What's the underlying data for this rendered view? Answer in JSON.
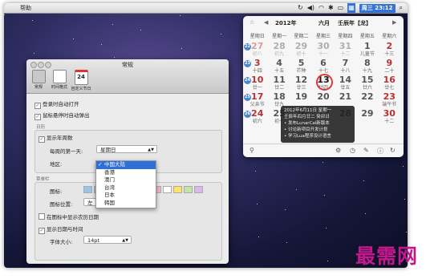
{
  "menubar": {
    "help_label": "帮助",
    "clock": "周三 23:12"
  },
  "calendar": {
    "year": "2012年",
    "month": "六月",
    "ganzhi": "壬辰年【龙】",
    "weekdays": [
      "星期日",
      "星期一",
      "星期二",
      "星期三",
      "星期四",
      "星期五",
      "星期六"
    ],
    "weeks": [
      {
        "badge": "22",
        "days": [
          {
            "d": "27",
            "l": "初八",
            "dim": true
          },
          {
            "d": "28",
            "l": "初九",
            "dim": true
          },
          {
            "d": "29",
            "l": "初十",
            "dim": true
          },
          {
            "d": "30",
            "l": "十一",
            "dim": true
          },
          {
            "d": "31",
            "l": "十二",
            "dim": true
          },
          {
            "d": "1",
            "l": "儿童节"
          },
          {
            "d": "2",
            "l": "十三"
          }
        ]
      },
      {
        "badge": "23",
        "days": [
          {
            "d": "3",
            "l": "十四"
          },
          {
            "d": "4",
            "l": "十五"
          },
          {
            "d": "5",
            "l": "芒种"
          },
          {
            "d": "6",
            "l": "十七"
          },
          {
            "d": "7",
            "l": "十八"
          },
          {
            "d": "8",
            "l": "十九"
          },
          {
            "d": "9",
            "l": "二十"
          }
        ]
      },
      {
        "badge": "24",
        "days": [
          {
            "d": "10",
            "l": "廿一"
          },
          {
            "d": "11",
            "l": "廿二"
          },
          {
            "d": "12",
            "l": "廿三"
          },
          {
            "d": "13",
            "l": "廿四",
            "today": true
          },
          {
            "d": "14",
            "l": "廿五"
          },
          {
            "d": "15",
            "l": "廿六"
          },
          {
            "d": "16",
            "l": "廿七"
          }
        ]
      },
      {
        "badge": "25",
        "days": [
          {
            "d": "17",
            "l": "父亲节"
          },
          {
            "d": "18",
            "l": "廿九"
          },
          {
            "d": "19",
            "l": ""
          },
          {
            "d": "20",
            "l": ""
          },
          {
            "d": "21",
            "l": ""
          },
          {
            "d": "22",
            "l": ""
          },
          {
            "d": "23",
            "l": "端午节"
          }
        ]
      },
      {
        "badge": "26",
        "days": [
          {
            "d": "24",
            "l": "初六"
          },
          {
            "d": "25",
            "l": "初七"
          },
          {
            "d": "26",
            "l": ""
          },
          {
            "d": "27",
            "l": ""
          },
          {
            "d": "28",
            "l": ""
          },
          {
            "d": "29",
            "l": ""
          },
          {
            "d": "30",
            "l": "十二"
          }
        ]
      }
    ],
    "tooltip": {
      "line1": "2012年6月11日 星期一",
      "line2": "壬辰年四月廿二 癸卯日",
      "events": [
        "发布LunarCal新版本",
        "讨论新项目开发计划",
        "学习Lua程序设计语言"
      ]
    }
  },
  "prefs": {
    "title": "常规",
    "tabs": [
      "常规",
      "时间格式",
      "自定义节日"
    ],
    "opt_login": "登录时自动打开",
    "opt_hover": "鼠标悬停时自动弹出",
    "section_calendar": "日历",
    "opt_weeknum": "显示年周数",
    "first_day_label": "每周的第一天:",
    "first_day_value": "星期日",
    "region_label": "地区:",
    "region_options": [
      "中国大陆",
      "香港",
      "澳门",
      "台湾",
      "日本",
      "韩国"
    ],
    "region_selected": "中国大陆",
    "section_menubar": "菜单栏",
    "icon_label": "图标:",
    "icon_pos_label": "图标位置:",
    "icon_pos_value": "左",
    "opt_lunar_icon": "在图标中显示农历日期",
    "opt_show_datetime": "显示日期与时间",
    "font_size_label": "字体大小:",
    "font_size_value": "14pt"
  },
  "watermark": "最需网"
}
